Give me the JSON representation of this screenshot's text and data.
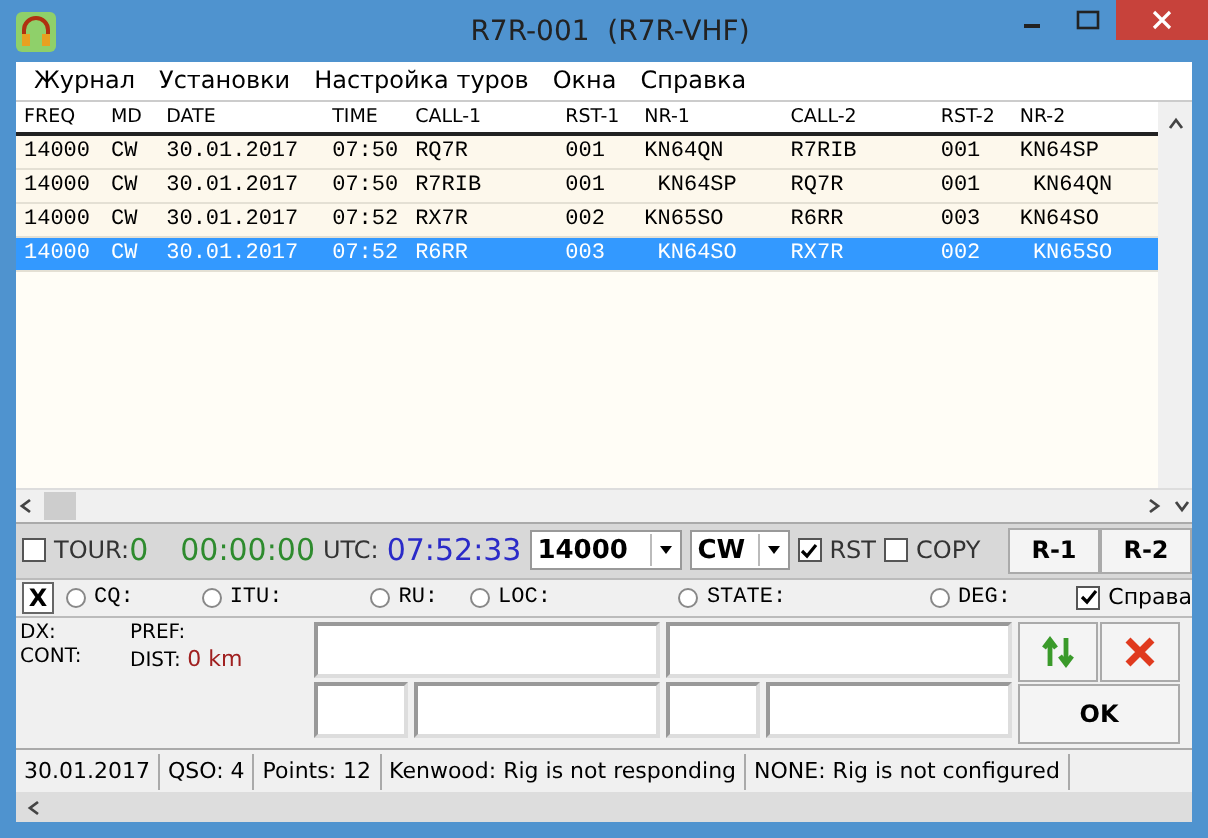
{
  "window": {
    "title": "R7R-001  (R7R-VHF)"
  },
  "menu": [
    "Журнал",
    "Установки",
    "Настройка туров",
    "Окна",
    "Справка"
  ],
  "table": {
    "columns": [
      "FREQ",
      "MD",
      "DATE",
      "TIME",
      "CALL-1",
      "RST-1",
      "NR-1",
      "CALL-2",
      "RST-2",
      "NR-2"
    ],
    "rows": [
      {
        "selected": false,
        "cells": [
          "14000",
          "CW",
          "30.01.2017",
          "07:50",
          "RQ7R",
          "001",
          "KN64QN",
          "R7RIB",
          "001",
          "KN64SP"
        ]
      },
      {
        "selected": false,
        "cells": [
          "14000",
          "CW",
          "30.01.2017",
          "07:50",
          "R7RIB",
          "001",
          " KN64SP",
          "RQ7R",
          "001",
          " KN64QN"
        ]
      },
      {
        "selected": false,
        "cells": [
          "14000",
          "CW",
          "30.01.2017",
          "07:52",
          "RX7R",
          "002",
          "KN65SO",
          "R6RR",
          "003",
          "KN64SO"
        ]
      },
      {
        "selected": true,
        "cells": [
          "14000",
          "CW",
          "30.01.2017",
          "07:52",
          "R6RR",
          "003",
          " KN64SO",
          "RX7R",
          "002",
          " KN65SO"
        ]
      }
    ]
  },
  "toolbar": {
    "tour": {
      "label": "TOUR:",
      "checked": false,
      "value": "0"
    },
    "timer": "00:00:00",
    "utc_label": "UTC:",
    "utc": "07:52:33",
    "frequency": "14000",
    "mode": "CW",
    "rst": {
      "label": "RST",
      "checked": true
    },
    "copy": {
      "label": "COPY",
      "checked": false
    },
    "buttons": [
      "R-1",
      "R-2"
    ]
  },
  "filters": {
    "clear": "X",
    "radios": [
      {
        "label": "CQ:",
        "selected": false
      },
      {
        "label": "ITU:",
        "selected": false
      },
      {
        "label": "RU:",
        "selected": false
      },
      {
        "label": "LOC:",
        "selected": false
      },
      {
        "label": "STATE:",
        "selected": false
      },
      {
        "label": "DEG:",
        "selected": false
      }
    ],
    "help": {
      "label": "Справа",
      "checked": true
    }
  },
  "info": {
    "dx": "DX:",
    "pref": "PREF:",
    "cont": "CONT:",
    "dist": "DIST:",
    "dist_value": "0 km"
  },
  "ok_button": "OK",
  "status_bar": [
    "30.01.2017",
    "QSO: 4",
    "Points: 12",
    "Kenwood: Rig is not responding",
    "NONE: Rig is not configured"
  ]
}
